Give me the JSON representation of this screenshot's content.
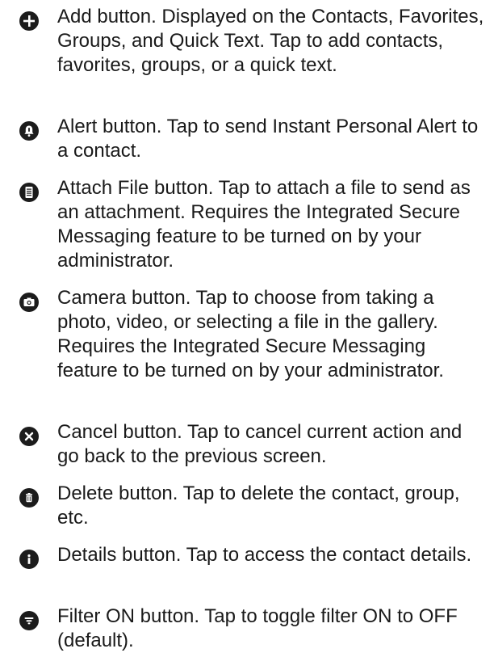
{
  "items": [
    {
      "icon": "add-icon",
      "text": "Add button. Displayed on the Contacts, Favorites, Groups, and Quick Text. Tap to add contacts, favorites, groups, or a quick text."
    },
    {
      "icon": "alert-icon",
      "text": "Alert button. Tap to send Instant Personal Alert to a contact."
    },
    {
      "icon": "attach-file-icon",
      "text": "Attach File button. Tap to attach a file to send as an attachment. Requires the Integrated Secure Messaging feature to be turned on by your administrator."
    },
    {
      "icon": "camera-icon",
      "text": "Camera button. Tap to choose from taking a photo, video, or selecting a file in the gallery. Requires the Integrated Secure Messaging feature to be turned on by your administrator."
    },
    {
      "icon": "cancel-icon",
      "text": "Cancel button. Tap to cancel current action and go back to the previous screen."
    },
    {
      "icon": "delete-icon",
      "text": "Delete button. Tap to delete the contact, group, etc."
    },
    {
      "icon": "details-icon",
      "text": "Details button. Tap to access the contact details."
    },
    {
      "icon": "filter-icon",
      "text": "Filter ON button. Tap to toggle filter ON to OFF (default)."
    }
  ]
}
